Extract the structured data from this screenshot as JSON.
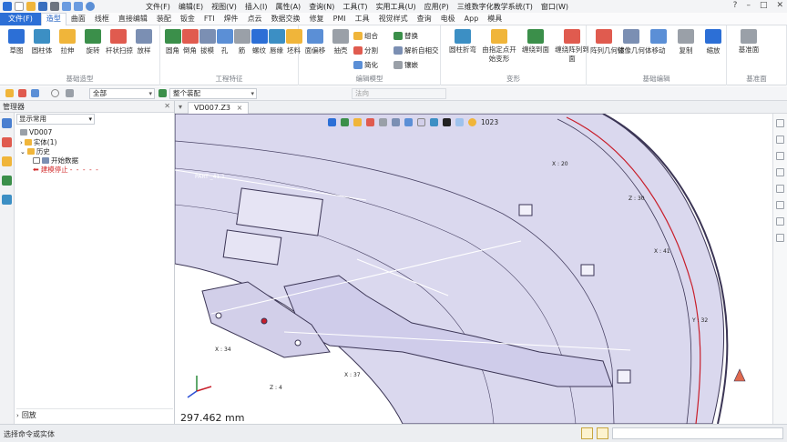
{
  "menu": {
    "items": [
      "文件(F)",
      "编辑(E)",
      "视图(V)",
      "插入(I)",
      "属性(A)",
      "查询(N)",
      "工具(T)",
      "实用工具(U)",
      "应用(P)",
      "三维数字化教学系统(T)",
      "窗口(W)"
    ],
    "window_controls": [
      "?",
      "–",
      "□",
      "✕"
    ]
  },
  "tabs": {
    "file": "文件(F)",
    "items": [
      "造型",
      "曲面",
      "线框",
      "直接编辑",
      "装配",
      "钣金",
      "FTI",
      "焊件",
      "点云",
      "数据交换",
      "修复",
      "PMI",
      "工具",
      "视觉样式",
      "查询",
      "电极",
      "App",
      "模具"
    ],
    "active_index": 0
  },
  "ribbon": {
    "groups": [
      {
        "label": "基础造型",
        "tools": [
          "草图",
          "圆柱体",
          "拉伸",
          "旋转",
          "杆状扫掠",
          "放样"
        ]
      },
      {
        "label": "工程特征",
        "tools": [
          "圆角",
          "倒角",
          "拔模",
          "孔",
          "筋",
          "螺纹",
          "唇缘",
          "坯料"
        ]
      },
      {
        "label": "编辑模型",
        "tools": [
          "面偏移",
          "抽壳"
        ],
        "small": [
          "组合",
          "替换",
          "分割",
          "解析自相交",
          "简化",
          "镶嵌"
        ]
      },
      {
        "label": "变形",
        "tools": [
          "圆柱折弯",
          "由指定点开始变形",
          "缠绕到面",
          "缠绕阵列到面"
        ]
      },
      {
        "label": "基础编辑",
        "tools": [
          "阵列几何体",
          "镜像几何体",
          "移动",
          "复制",
          "缩放"
        ]
      },
      {
        "label": "基准面",
        "tools": [
          "基准面"
        ]
      }
    ]
  },
  "filterbar": {
    "filter_value": "全部",
    "assembly_value": "整个装配",
    "direction_placeholder": "法向"
  },
  "manager": {
    "title": "管理器",
    "close": "✕",
    "tree_filter": "显示常用",
    "root": "VD007",
    "nodes": [
      "实体(1)",
      "历史",
      "开始数据",
      "建模停止"
    ],
    "rollback": "回放"
  },
  "document": {
    "tab_label": "VD007.Z3",
    "tab_close": "×"
  },
  "viewport": {
    "view_number": "1023",
    "measure": "297.462 mm",
    "annotations": [
      "X : 20",
      "Z : 30",
      "X : 41",
      "Y : 32",
      "X : 37",
      "Z : 4",
      "X : 34"
    ],
    "sketch_label": "PART _41.1"
  },
  "status": {
    "text": "选择命令或实体"
  },
  "colors": {
    "accent": "#2c6fd6",
    "part_fill": "#d8d6ec",
    "edge_red": "#c81e2a",
    "edge_dark": "#3b3555"
  }
}
